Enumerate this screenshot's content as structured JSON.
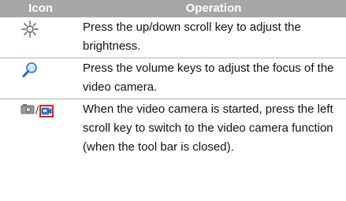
{
  "table": {
    "header": {
      "icon": "Icon",
      "operation": "Operation"
    },
    "rows": [
      {
        "icon": "brightness-icon",
        "text": "Press the up/down scroll key to adjust the brightness."
      },
      {
        "icon": "magnifier-icon",
        "text": " Press the volume keys to adjust the focus of the video camera."
      },
      {
        "icon": "camera-video-toggle-icon",
        "separator": "/",
        "text": "When the video camera is started, press the left scroll key to switch to the video camera function (when the tool bar is closed)."
      }
    ]
  },
  "colors": {
    "header_bg": "#a6a6a6",
    "header_text": "#ffffff",
    "row_divider": "#b3b3b3",
    "highlight_box": "#e02020",
    "magnifier": "#3a7fd6"
  }
}
